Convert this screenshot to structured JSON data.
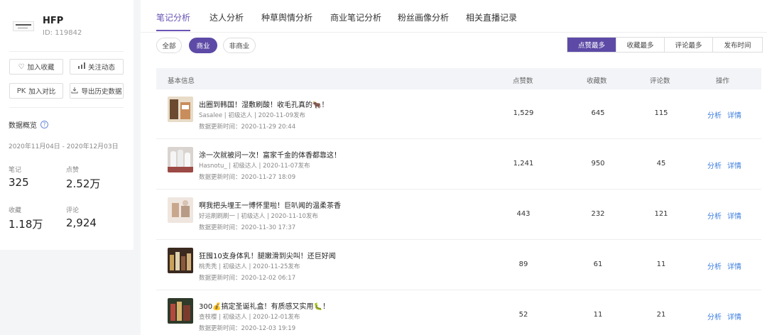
{
  "profile": {
    "name": "HFP",
    "id": "ID: 119842"
  },
  "sidebar": {
    "buttons": [
      {
        "label": "加入收藏",
        "icon": "heart-icon"
      },
      {
        "label": "关注动态",
        "icon": "chart-icon"
      },
      {
        "label": "加入对比",
        "icon": "pk-icon"
      },
      {
        "label": "导出历史数据",
        "icon": "download-icon"
      }
    ],
    "pk_label": "PK",
    "overview_title": "数据概览",
    "date_range": "2020年11月04日 - 2020年12月03日",
    "stats": [
      {
        "label": "笔记",
        "value": "325"
      },
      {
        "label": "点赞",
        "value": "2.52万"
      },
      {
        "label": "收藏",
        "value": "1.18万"
      },
      {
        "label": "评论",
        "value": "2,924"
      }
    ]
  },
  "tabs": [
    "笔记分析",
    "达人分析",
    "种草舆情分析",
    "商业笔记分析",
    "粉丝画像分析",
    "相关直播记录"
  ],
  "filters": [
    "全部",
    "商业",
    "非商业"
  ],
  "sort_buttons": [
    "点赞最多",
    "收藏最多",
    "评论最多",
    "发布时间"
  ],
  "table": {
    "headers": [
      "基本信息",
      "点赞数",
      "收藏数",
      "评论数",
      "操作"
    ],
    "rows": [
      {
        "title": "出圈到韩国！湿敷刷酸！收毛孔真的🐂！",
        "meta": "Sasalee | 初级达人 | 2020-11-09发布",
        "updated": "数据更新时间：2020-11-29 20:44",
        "likes": "1,529",
        "collects": "645",
        "comments": "115"
      },
      {
        "title": "涂一次就被问一次！富家千金的体香都靠这！",
        "meta": "Hasnotu_ | 初级达人 | 2020-11-07发布",
        "updated": "数据更新时间：2020-11-27 18:09",
        "likes": "1,241",
        "collects": "950",
        "comments": "45"
      },
      {
        "title": "啊我把头埋王一博怀里啦！巨叭闻的温柔茶香",
        "meta": "好运刷刷刷一 | 初级达人 | 2020-11-10发布",
        "updated": "数据更新时间：2020-11-30 17:37",
        "likes": "443",
        "collects": "232",
        "comments": "121"
      },
      {
        "title": "狂囤10支身体乳！腿嫩滑到尖叫！还巨好闻",
        "meta": "桃秃秃 | 初级达人 | 2020-11-25发布",
        "updated": "数据更新时间：2020-12-02 06:17",
        "likes": "89",
        "collects": "61",
        "comments": "11"
      },
      {
        "title": "300💰搞定圣诞礼盒！有质感又实用🐛！",
        "meta": "查枝樱 | 初级达人 | 2020-12-01发布",
        "updated": "数据更新时间：2020-12-03 19:19",
        "likes": "52",
        "collects": "11",
        "comments": "21"
      }
    ],
    "actions": {
      "analyze": "分析",
      "detail": "详情"
    }
  }
}
